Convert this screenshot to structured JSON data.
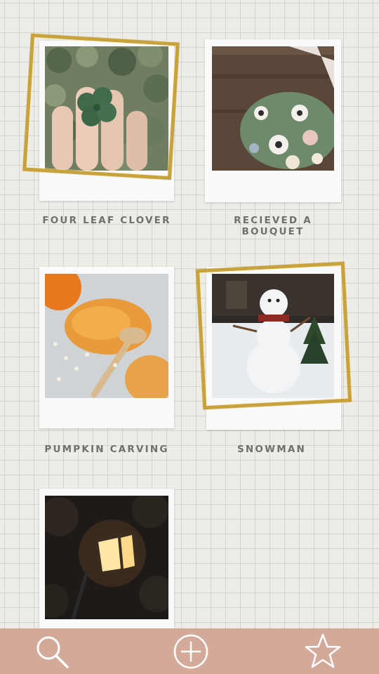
{
  "cards": [
    {
      "caption": "FOUR LEAF CLOVER"
    },
    {
      "caption": "RECIEVED A BOUQUET"
    },
    {
      "caption": "PUMPKIN CARVING"
    },
    {
      "caption": "SNOWMAN"
    },
    {
      "caption": ""
    }
  ],
  "nav": {
    "items": [
      {
        "icon": "search-icon"
      },
      {
        "icon": "plus-circle-icon"
      },
      {
        "icon": "star-icon"
      }
    ],
    "background": "#d3a99a"
  },
  "colors": {
    "accent_gold": "#c8a23a",
    "caption_text": "#6f6f6f",
    "background": "#eeece7"
  }
}
